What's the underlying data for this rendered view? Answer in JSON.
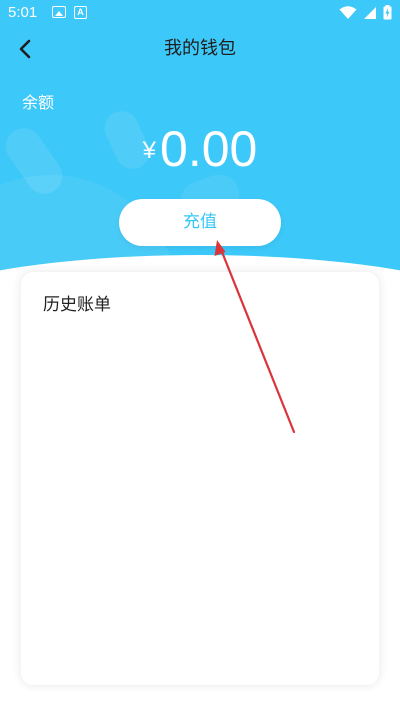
{
  "status_bar": {
    "time": "5:01",
    "a_icon_text": "A",
    "icons": [
      "image-icon",
      "a-icon",
      "wifi-icon",
      "signal-icon",
      "battery-charging-icon"
    ]
  },
  "nav": {
    "title": "我的钱包",
    "back_icon": "back-arrow-icon"
  },
  "balance": {
    "label": "余额",
    "currency": "¥",
    "amount": "0.00"
  },
  "recharge_button": {
    "label": "充值"
  },
  "history": {
    "title": "历史账单"
  },
  "colors": {
    "header_blue": "#3cc8f8",
    "button_text": "#35c6f5",
    "annotation_red": "#d9353a"
  }
}
